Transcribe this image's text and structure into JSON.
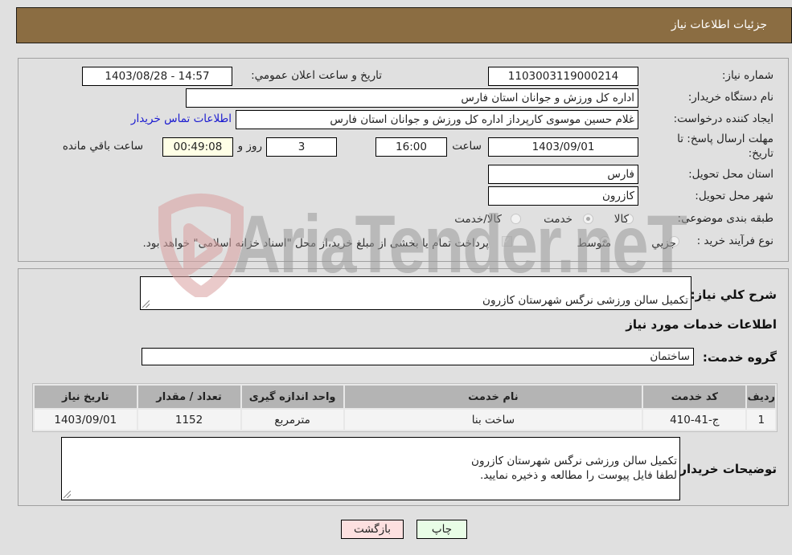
{
  "header": {
    "title": "جزئيات اطلاعات نياز"
  },
  "form": {
    "need_number": {
      "label": "شماره نياز:",
      "value": "1103003119000214"
    },
    "announce": {
      "label": "تاريخ و ساعت اعلان عمومي:",
      "value": "1403/08/28 - 14:57"
    },
    "buyer_org": {
      "label": "نام دستگاه خريدار:",
      "value": "اداره کل ورزش و جوانان استان فارس"
    },
    "requester": {
      "label": "ايجاد کننده درخواست:",
      "value": "غلام حسين موسوی کارپرداز اداره کل ورزش و جوانان استان فارس",
      "contact_link": "اطلاعات تماس خريدار"
    },
    "deadline": {
      "label_line1": "مهلت ارسال پاسخ: تا",
      "label_line2": "تاريخ:",
      "date": "1403/09/01",
      "time_label": "ساعت",
      "time": "16:00",
      "days": "3",
      "days_label": "روز و",
      "remaining": "00:49:08",
      "remaining_label": "ساعت باقي مانده"
    },
    "province": {
      "label": "استان محل تحويل:",
      "value": "فارس"
    },
    "city": {
      "label": "شهر محل تحويل:",
      "value": "کازرون"
    },
    "category": {
      "label": "طبقه بندی موضوعی:",
      "options": [
        "کالا",
        "خدمت",
        "کالا/خدمت"
      ],
      "selected": "خدمت"
    },
    "purchase_type": {
      "label": "نوع فرآيند خريد :",
      "options": [
        "جزيي",
        "متوسط"
      ],
      "selected": "متوسط",
      "payment_checkbox_checked": true,
      "payment_note": "پرداخت تمام يا بخشی از مبلغ خريد،از محل \"اسناد خزانه اسلامی\" خواهد بود."
    }
  },
  "details": {
    "summary_label": "شرح کلي نياز:",
    "summary_value": "تکميل سالن ورزشی نرگس شهرستان کازرون",
    "services_heading": "اطلاعات خدمات مورد نياز",
    "service_group_label": "گروه خدمت:",
    "service_group_value": "ساختمان",
    "table": {
      "headers": [
        "رديف",
        "کد خدمت",
        "نام خدمت",
        "واحد اندازه گيری",
        "تعداد / مقدار",
        "تاريخ نياز"
      ],
      "rows": [
        [
          "1",
          "ج-41-410",
          "ساخت بنا",
          "مترمربع",
          "1152",
          "1403/09/01"
        ]
      ]
    },
    "buyer_notes_label": "توضيحات خريدار:",
    "buyer_notes_value": "تکميل سالن ورزشی نرگس شهرستان کازرون\nلطفا فايل پيوست را مطالعه و ذخيره نماييد."
  },
  "buttons": {
    "print": "چاپ",
    "back": "بازگشت"
  },
  "watermark": {
    "text": "AriaTender.neT"
  },
  "colors": {
    "header_bg": "#8b6d42",
    "link": "#1a1ad0",
    "print_bg": "#e8fde6",
    "back_bg": "#fde0e0"
  }
}
